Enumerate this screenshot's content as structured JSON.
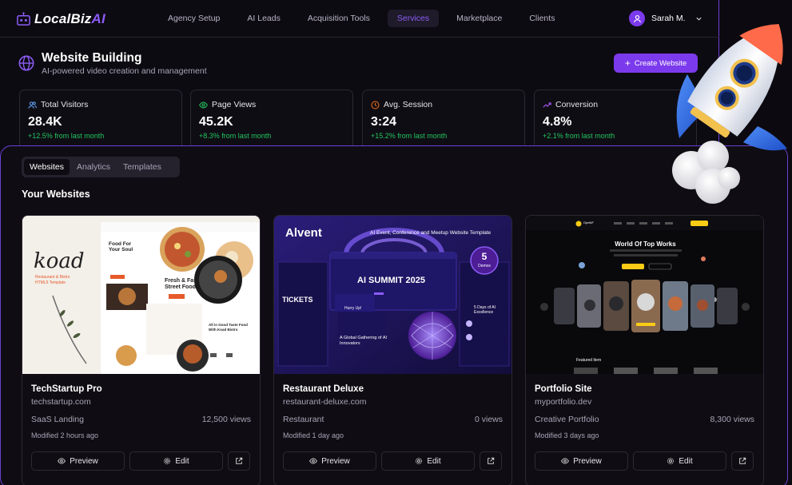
{
  "brand": {
    "name_main": "LocalBiz",
    "name_accent": "AI"
  },
  "nav": {
    "items": [
      {
        "label": "Agency Setup",
        "active": false
      },
      {
        "label": "AI Leads",
        "active": false
      },
      {
        "label": "Acquisition Tools",
        "active": false
      },
      {
        "label": "Services",
        "active": true
      },
      {
        "label": "Marketplace",
        "active": false
      },
      {
        "label": "Clients",
        "active": false
      }
    ]
  },
  "user": {
    "name": "Sarah M."
  },
  "header": {
    "title": "Website Building",
    "subtitle": "AI-powered video creation and management",
    "create_button": "Create Website"
  },
  "stats": [
    {
      "label": "Total Visitors",
      "value": "28.4K",
      "change": "+12.5% from last month",
      "icon": "users-icon"
    },
    {
      "label": "Page Views",
      "value": "45.2K",
      "change": "+8.3% from last month",
      "icon": "eye-icon"
    },
    {
      "label": "Avg. Session",
      "value": "3:24",
      "change": "+15.2% from last month",
      "icon": "clock-icon"
    },
    {
      "label": "Conversion",
      "value": "4.8%",
      "change": "+2.1% from last month",
      "icon": "trend-icon"
    }
  ],
  "tabs": [
    {
      "label": "Websites",
      "active": true
    },
    {
      "label": "Analytics",
      "active": false
    },
    {
      "label": "Templates",
      "active": false
    }
  ],
  "section_title": "Your Websites",
  "websites": [
    {
      "title": "TechStartup Pro",
      "domain": "techstartup.com",
      "category": "SaaS Landing",
      "views": "12,500 views",
      "modified": "Modified 2 hours ago",
      "thumb": {
        "brand": "koad",
        "tagline_1": "Restaurant & Bistro",
        "tagline_2": "HTML5 Template",
        "headline_1": "Food For Your Soul",
        "headline_2": "Fresh & Fast Street Food",
        "headline_3": "All in Good Taste Food With Koad Bistro"
      }
    },
    {
      "title": "Restaurant Deluxe",
      "domain": "restaurant-deluxe.com",
      "category": "Restaurant",
      "views": "0 views",
      "modified": "Modified 1 day ago",
      "thumb": {
        "brand": "Alvent",
        "tagline": "AI Event, Conference and Meetup Website Template",
        "badge_num": "5",
        "badge_label": "Demos",
        "summit": "AI SUMMIT 2025",
        "tickets": "TICKETS",
        "gathering": "A Global Gathering of AI Innovators",
        "hurry": "Hurry Up!",
        "days": "5 Days of AI Excellence"
      }
    },
    {
      "title": "Portfolio Site",
      "domain": "myportfolio.dev",
      "category": "Creative Portfolio",
      "views": "8,300 views",
      "modified": "Modified 3 days ago",
      "thumb": {
        "brand": "OpeNF",
        "headline": "World Of Top Works",
        "featured": "Featured Item"
      }
    }
  ],
  "card_actions": {
    "preview": "Preview",
    "edit": "Edit"
  },
  "colors": {
    "accent": "#7c3aed",
    "accent_text": "#8b5cf6",
    "positive": "#22c55e",
    "border": "#6b3fd4"
  }
}
